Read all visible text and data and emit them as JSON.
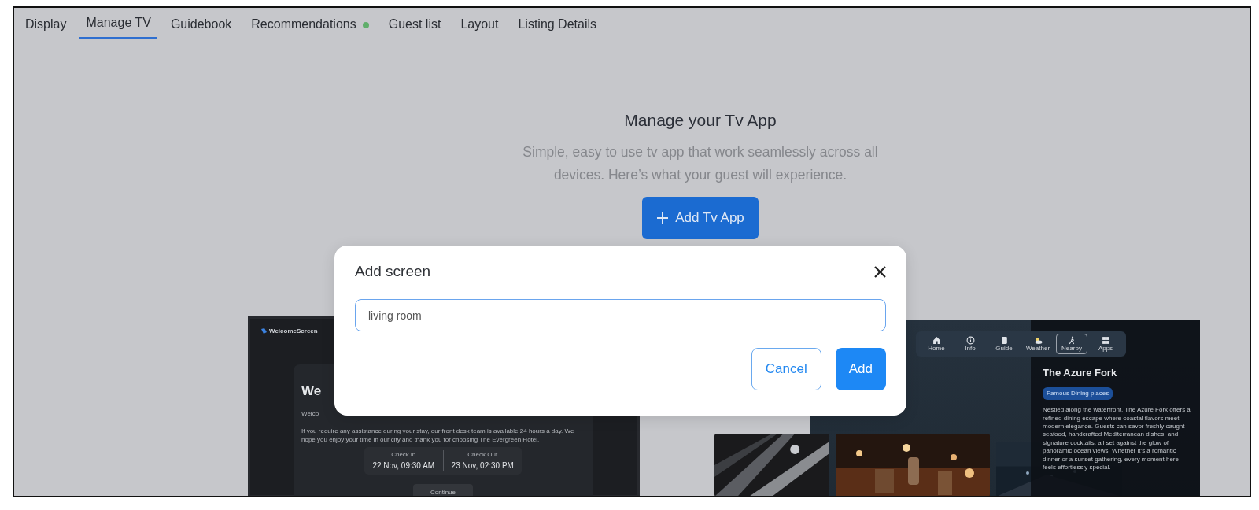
{
  "tabs": [
    {
      "label": "Display",
      "selected": false,
      "dot": false
    },
    {
      "label": "Manage TV",
      "selected": true,
      "dot": false
    },
    {
      "label": "Guidebook",
      "selected": false,
      "dot": false
    },
    {
      "label": "Recommendations",
      "selected": false,
      "dot": true
    },
    {
      "label": "Guest list",
      "selected": false,
      "dot": false
    },
    {
      "label": "Layout",
      "selected": false,
      "dot": false
    },
    {
      "label": "Listing Details",
      "selected": false,
      "dot": false
    }
  ],
  "hero": {
    "title": "Manage your Tv App",
    "subtitle": "Simple, easy to use tv app that work seamlessly across all devices. Here’s what your guest will experience.",
    "button": "Add Tv App"
  },
  "welcome_preview": {
    "logo": "WelcomeScreen",
    "heading": "We",
    "intro": "Welco",
    "paragraph": "If you require any assistance during your stay, our front desk team is available 24 hours a day. We hope you enjoy your time in our city and thank you for choosing The Evergreen Hotel.",
    "check_in": {
      "label": "Check in",
      "value": "22 Nov, 09:30 AM"
    },
    "check_out": {
      "label": "Check Out",
      "value": "23 Nov, 02:30 PM"
    },
    "button": "Continue"
  },
  "nearby_preview": {
    "nav": [
      {
        "label": "Home",
        "selected": false
      },
      {
        "label": "Info",
        "selected": false
      },
      {
        "label": "Guide",
        "selected": false
      },
      {
        "label": "Weather",
        "selected": false
      },
      {
        "label": "Nearby",
        "selected": true
      },
      {
        "label": "Apps",
        "selected": false
      }
    ],
    "title": "The Azure Fork",
    "tag": "Famous Dining places",
    "description": "Nestled along the waterfront, The Azure Fork offers a refined dining escape where coastal flavors meet modern elegance. Guests can savor freshly caught seafood, handcrafted Mediterranean dishes, and signature cocktails, all set against the glow of panoramic ocean views. Whether it’s a romantic dinner or a sunset gathering, every moment here feels effortlessly special."
  },
  "dialog": {
    "title": "Add screen",
    "input_value": "living room",
    "buttons": [
      {
        "label": "Cancel",
        "kind": "secondary"
      },
      {
        "label": "Add",
        "kind": "primary"
      }
    ]
  }
}
